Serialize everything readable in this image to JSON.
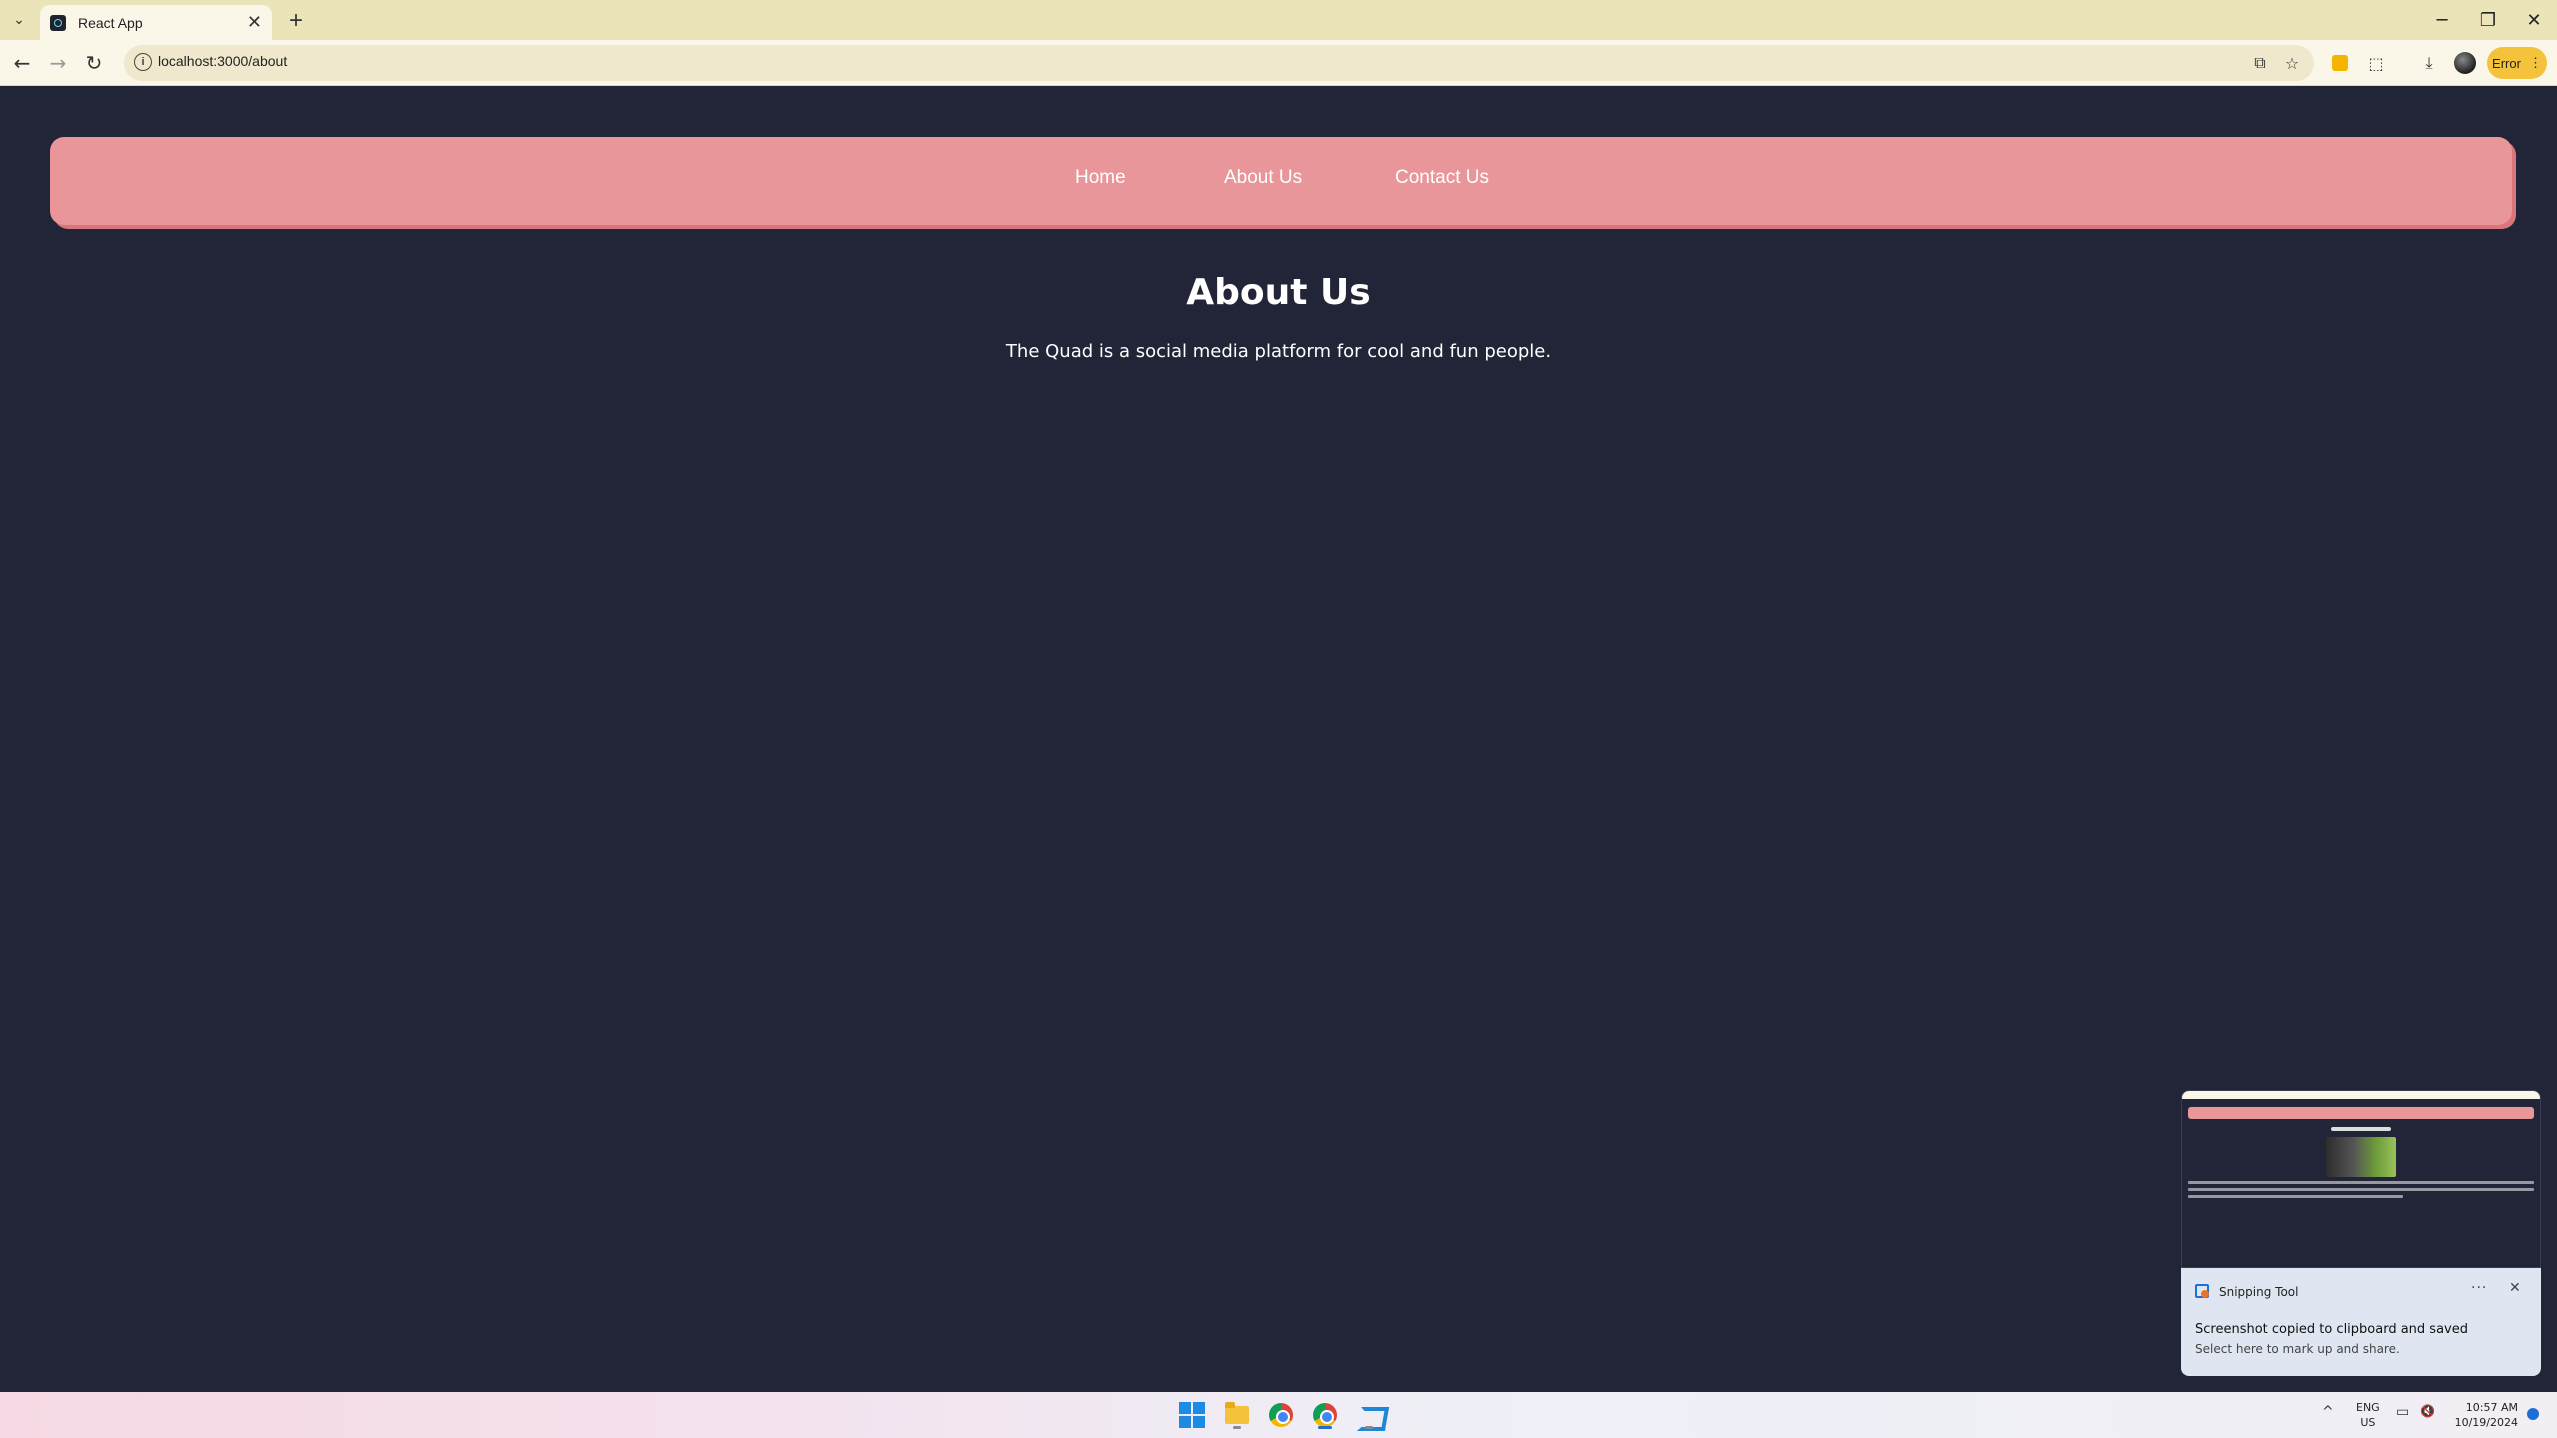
{
  "browser": {
    "tab_title": "React App",
    "url": "localhost:3000/about",
    "error_label": "Error",
    "icons": {
      "tab_search": "chevron-down-icon",
      "tab_close": "close-icon",
      "new_tab": "plus-icon",
      "back": "back-arrow-icon",
      "forward": "forward-arrow-icon",
      "reload": "reload-icon",
      "site_info": "info-icon",
      "install": "install-app-icon",
      "bookmark": "star-icon",
      "extension": "extension-icon",
      "puzzle": "puzzle-icon",
      "download": "download-icon",
      "profile": "avatar",
      "menu": "kebab-menu-icon"
    },
    "glyphs": {
      "tab_search": "⌄",
      "tab_close": "✕",
      "new_tab": "+",
      "back": "←",
      "forward": "→",
      "reload": "↻",
      "site_info": "i",
      "install": "⧉",
      "bookmark": "☆",
      "puzzle": "⬚",
      "download": "⤓",
      "menu": "⋮",
      "minimize": "─",
      "restore": "❐",
      "close": "✕"
    }
  },
  "navbar": {
    "links": [
      {
        "label": "Home"
      },
      {
        "label": "About Us"
      },
      {
        "label": "Contact Us"
      }
    ],
    "color": "#e8969a"
  },
  "page": {
    "title": "About Us",
    "description": "The Quad is a social media platform for cool and fun people.",
    "background": "#222537"
  },
  "snipping_toast": {
    "app_name": "Snipping Tool",
    "more_glyph": "···",
    "close_glyph": "✕",
    "message": "Screenshot copied to clipboard and saved",
    "sub_message": "Select here to mark up and share."
  },
  "taskbar": {
    "apps": [
      "start-icon",
      "file-explorer-icon",
      "chrome-icon",
      "chrome-profile-icon",
      "vscode-icon"
    ],
    "tray": {
      "chevron": "^",
      "lang_line1": "ENG",
      "lang_line2": "US",
      "monitor_glyph": "▭",
      "volume_glyph": "🔇",
      "time": "10:57 AM",
      "date": "10/19/2024"
    }
  }
}
